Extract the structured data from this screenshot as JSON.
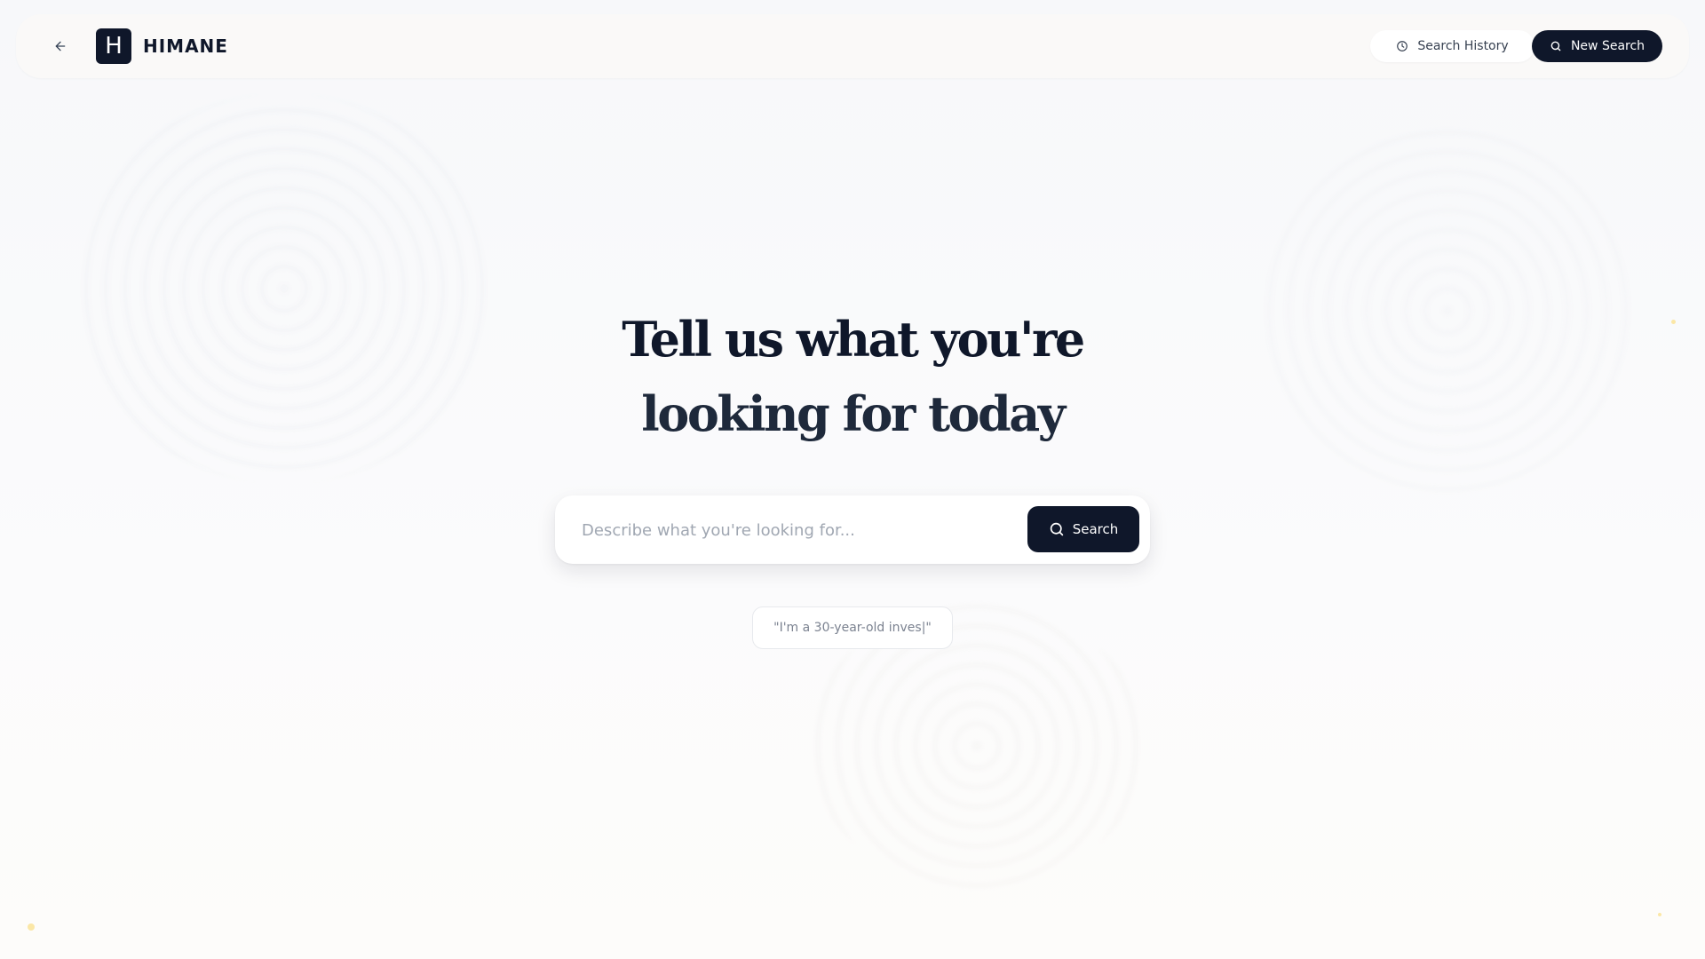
{
  "app": {
    "brand_letter": "H",
    "brand_name": "HIMANE"
  },
  "header": {
    "back_icon": "arrow-left-icon",
    "search_history_label": "Search History",
    "search_history_icon": "clock-icon",
    "new_search_label": "New Search",
    "new_search_icon": "search-icon"
  },
  "hero": {
    "headline_line1": "Tell us what you're",
    "headline_line2": "looking for today"
  },
  "search": {
    "placeholder": "Describe what you're looking for...",
    "value": "",
    "button_label": "Search",
    "button_icon": "search-icon"
  },
  "suggestion": {
    "text": "\"I'm a 30-year-old inves|\""
  },
  "colors": {
    "primary": "#0f172a",
    "background": "#f8f9fb",
    "accent_dot": "#fbe7a6"
  }
}
